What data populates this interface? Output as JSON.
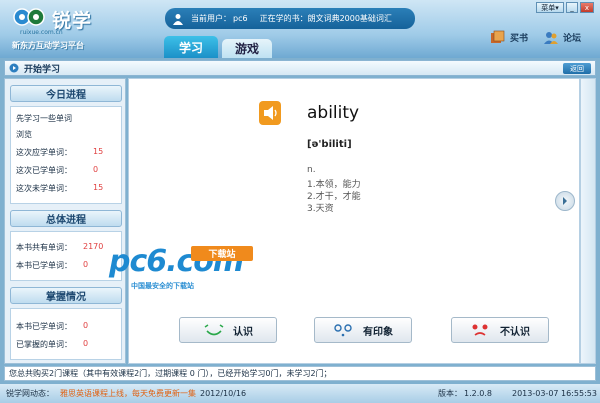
{
  "app": {
    "logo_text": "锐学",
    "domain": "ruixue.com.cn",
    "slogan": "新东方互动学习平台"
  },
  "window_controls": {
    "menu": "菜单▾",
    "minimize": "_",
    "close": "x"
  },
  "user_bar": {
    "user_label": "当前用户：",
    "user_name": "pc6",
    "book_label": "正在学的书：",
    "book_name": "朗文词典2000基础词汇"
  },
  "tabs": [
    {
      "label": "学习"
    },
    {
      "label": "游戏"
    }
  ],
  "header_links": {
    "buy": "买书",
    "forum": "论坛"
  },
  "title_bar": {
    "title": "开始学习",
    "back": "返回"
  },
  "sidebar": {
    "today": {
      "heading": "今日进程",
      "line1": "先学习一些单词",
      "line2": "浏览",
      "rows": [
        {
          "label": "这次应学单词：",
          "value": "15"
        },
        {
          "label": "这次已学单词：",
          "value": "0"
        },
        {
          "label": "这次未学单词：",
          "value": "15"
        }
      ]
    },
    "overall": {
      "heading": "总体进程",
      "rows": [
        {
          "label": "本书共有单词：",
          "value": "2170"
        },
        {
          "label": "本书已学单词：",
          "value": "0"
        }
      ]
    },
    "mastery": {
      "heading": "掌握情况",
      "rows": [
        {
          "label": "本书已学单词：",
          "value": "0"
        },
        {
          "label": "已掌握的单词：",
          "value": "0"
        }
      ]
    }
  },
  "word_card": {
    "word": "ability",
    "phonetic": "[ə'biliti]",
    "pos": "n.",
    "definitions": [
      "1.本领，能力",
      "2.才干，才能",
      "3.天资"
    ]
  },
  "watermark": {
    "big": "pc6.com",
    "badge": "下载站",
    "sub": "中国最安全的下载站"
  },
  "answers": {
    "know": "认识",
    "maybe": "有印象",
    "dont": "不认识"
  },
  "status1": {
    "text": "您总共购买2门课程（其中有效课程2门，过期课程 0 门），已经开始学习0门，未学习2门；"
  },
  "status2": {
    "news_label": "锐学网动态：",
    "news_text": "雅思英语课程上线，每天免费更新一集",
    "news_date": "2012/10/16",
    "version_label": "版本：",
    "version": "1.2.0.8",
    "datetime": "2013-03-07 16:55:53"
  },
  "colors": {
    "accent": "#1b90c8",
    "number": "#e04040",
    "news": "#e06010"
  }
}
